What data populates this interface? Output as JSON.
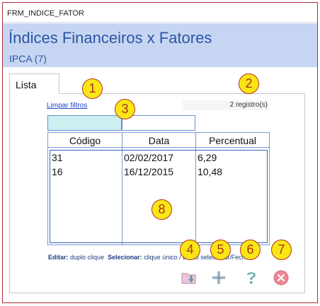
{
  "window": {
    "title": "FRM_INDICE_FATOR"
  },
  "header": {
    "title": "Índices Financeiros x Fatores",
    "subtitle": "IPCA (7)"
  },
  "tabs": [
    {
      "label": "Lista"
    }
  ],
  "list": {
    "clear_filters_label": "Limpar filtros",
    "record_count": "2 registro(s)",
    "filter_codigo_value": "",
    "filter_data_value": "",
    "columns": [
      "Código",
      "Data",
      "Percentual"
    ],
    "rows": [
      {
        "codigo": "31",
        "data": "02/02/2017",
        "percentual": "6,29"
      },
      {
        "codigo": "16",
        "data": "16/12/2015",
        "percentual": "10,48"
      }
    ]
  },
  "hint": {
    "edit_label": "Editar:",
    "edit_text": "duplo clique",
    "select_label": "Selecionar:",
    "select_text": "clique único / botão selecionar/Fechar"
  },
  "callouts": [
    "1",
    "2",
    "3",
    "4",
    "5",
    "6",
    "7",
    "8"
  ],
  "toolbar": {
    "icons": [
      "export-icon",
      "add-icon",
      "help-icon",
      "close-icon"
    ]
  },
  "colors": {
    "header_bg": "#c6d6f2",
    "header_text": "#2d55a5",
    "window_border": "#b22a3a",
    "callout_fill": "#f9e614",
    "callout_border": "#b4331d"
  }
}
